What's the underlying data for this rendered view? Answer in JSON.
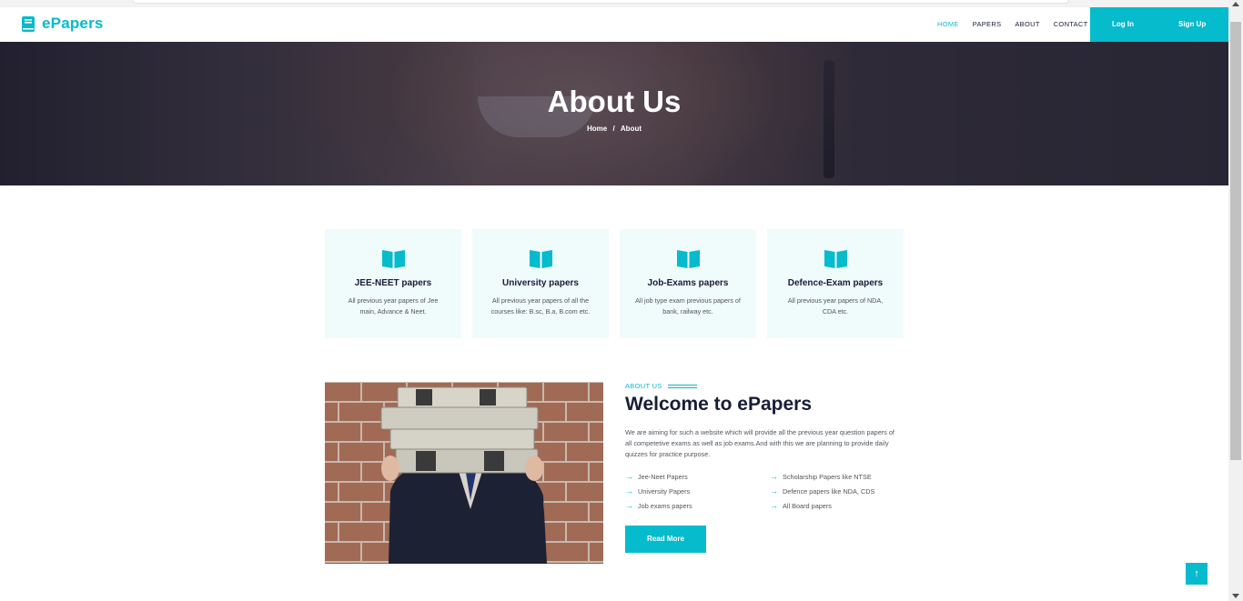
{
  "brand": {
    "name": "ePapers",
    "icon": "book-icon"
  },
  "nav": {
    "links": [
      {
        "label": "HOME",
        "active": true
      },
      {
        "label": "PAPERS",
        "active": false
      },
      {
        "label": "ABOUT",
        "active": false
      },
      {
        "label": "CONTACT",
        "active": false
      }
    ],
    "login_label": "Log In",
    "signup_label": "Sign Up"
  },
  "hero": {
    "title": "About Us",
    "breadcrumb": [
      "Home",
      "/",
      "About"
    ]
  },
  "cards": [
    {
      "icon": "book-open-icon",
      "title": "JEE-NEET papers",
      "desc": "All previous year papers of Jee main, Advance & Neet."
    },
    {
      "icon": "book-open-icon",
      "title": "University papers",
      "desc": "All previous year papers of all the courses like: B.sc, B.a, B.com etc."
    },
    {
      "icon": "book-open-icon",
      "title": "Job-Exams papers",
      "desc": "All job type exam previous papers of bank, railway etc."
    },
    {
      "icon": "book-open-icon",
      "title": "Defence-Exam papers",
      "desc": "All previous year papers of NDA, CDA etc."
    }
  ],
  "about": {
    "tag": "ABOUT US",
    "title": "Welcome to ePapers",
    "description": "We are aiming for such a website which will provide all the previous year question papers of all competetive exams as well as job exams.And with this we are planning to provide daily quizzes for practice purpose.",
    "features": [
      "Jee-Neet Papers",
      "Scholarship Papers like NTSE",
      "University Papers",
      "Defence papers like NDA, CDS",
      "Job exams papers",
      "All Board papers"
    ],
    "read_more_label": "Read More"
  },
  "back_to_top": {
    "icon": "arrow-up-icon",
    "glyph": "↑"
  },
  "colors": {
    "accent": "#06bbcc",
    "dark": "#181d38",
    "card_bg": "#f0fbfc"
  }
}
